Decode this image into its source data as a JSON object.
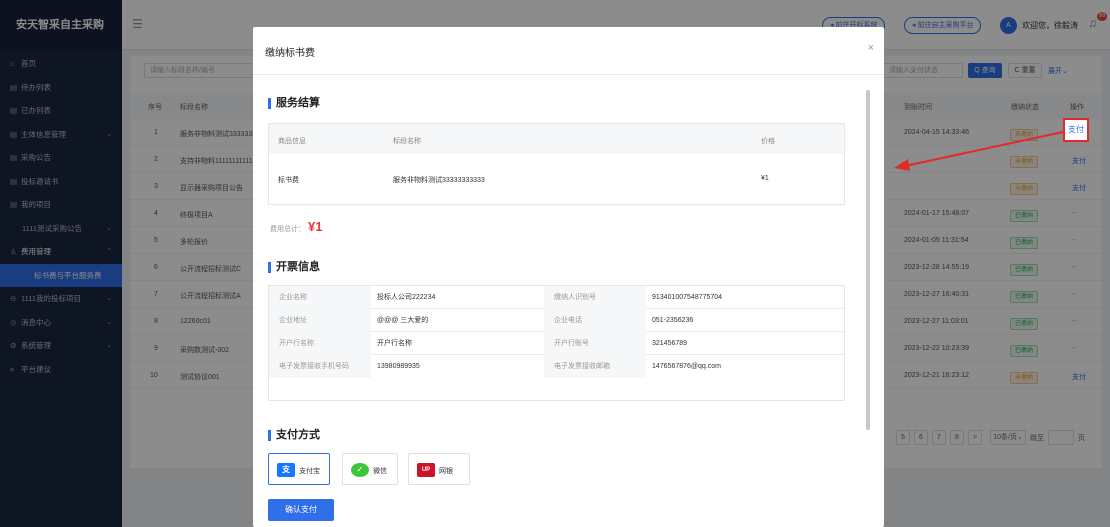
{
  "app": {
    "title": "安天智采自主采购"
  },
  "sidebar": {
    "items": [
      {
        "icon": "⌂",
        "label": "首页"
      },
      {
        "icon": "▤",
        "label": "待办列表"
      },
      {
        "icon": "▤",
        "label": "已办列表"
      },
      {
        "icon": "▤",
        "label": "主体信息管理",
        "arrow": "⌄"
      },
      {
        "icon": "▤",
        "label": "采购公告"
      },
      {
        "icon": "▤",
        "label": "投标邀请书"
      },
      {
        "icon": "▤",
        "label": "我的项目"
      },
      {
        "label": "1111测试采购公告",
        "arrow": "⌄"
      },
      {
        "icon": "♙",
        "label": "费用管理",
        "arrow": "⌃"
      },
      {
        "label": "标书费与平台服务费"
      },
      {
        "icon": "⊖",
        "label": "1111我的投标项目",
        "arrow": "⌄"
      },
      {
        "icon": "◎",
        "label": "消息中心",
        "arrow": "⌄"
      },
      {
        "icon": "⚙",
        "label": "系统管理",
        "arrow": "⌄"
      },
      {
        "icon": "≡",
        "label": "平台建议"
      }
    ]
  },
  "topbar": {
    "link1": "◂ 前往开标系统",
    "link2": "◂ 前往自主采购平台",
    "avatar": "A",
    "welcome": "欢迎您，徐毅涛",
    "badge": "99"
  },
  "filters": {
    "search_placeholder": "请输入标段名称/编号",
    "search2_placeholder": "请输入支付状态",
    "query": "Q 查询",
    "reset": "C 重置",
    "expand": "展开⌄"
  },
  "table": {
    "headers": {
      "index": "序号",
      "name": "标段名称",
      "time": "到账时间",
      "status": "缴纳状态",
      "action": "操作"
    },
    "rows": [
      {
        "index": "1",
        "name": "服务非物料测试33333333333",
        "time": "2024-04-15 14:33:46",
        "status": "未缴纳",
        "action": "支付"
      },
      {
        "index": "2",
        "name": "支持非物料11111111111",
        "time": "",
        "status": "未缴纳",
        "action": "支付"
      },
      {
        "index": "3",
        "name": "显示器采购项目公告",
        "time": "",
        "status": "未缴纳",
        "action": "支付"
      },
      {
        "index": "4",
        "name": "终极项目A",
        "time": "2024-01-17 15:48:07",
        "status": "已缴纳",
        "action": "--"
      },
      {
        "index": "5",
        "name": "多轮报价",
        "time": "2024-01-05 11:31:54",
        "status": "已缴纳",
        "action": "--"
      },
      {
        "index": "6",
        "name": "公开流程招标测试C",
        "time": "2023-12-28 14:55:19",
        "status": "已缴纳",
        "action": "--"
      },
      {
        "index": "7",
        "name": "公开流程招标测试A",
        "time": "2023-12-27 16:40:31",
        "status": "已缴纳",
        "action": "--"
      },
      {
        "index": "8",
        "name": "12260c01",
        "time": "2023-12-27 11:03:01",
        "status": "已缴纳",
        "action": "--"
      },
      {
        "index": "9",
        "name": "采购数测试-002",
        "time": "2023-12-22 10:23:39",
        "status": "已缴纳",
        "action": "--"
      },
      {
        "index": "10",
        "name": "测试协议001",
        "time": "2023-12-21 16:23:12",
        "status": "未缴纳",
        "action": "支付"
      }
    ]
  },
  "pagination": {
    "p5": "5",
    "p6": "6",
    "p7": "7",
    "p8": "8",
    "next": ">",
    "size": "10条/页⌄",
    "goto": "跳至",
    "page_unit": "页"
  },
  "modal": {
    "title": "缴纳标书费",
    "close": "×",
    "service_section": "服务结算",
    "service_headers": {
      "item": "商品信息",
      "name": "标段名称",
      "price": "价格"
    },
    "service_row": {
      "item": "标书费",
      "name": "服务非物料测试33333333333",
      "price": "¥1"
    },
    "total_label": "费用总计：",
    "total_value": "¥1",
    "invoice_section": "开票信息",
    "invoice": [
      {
        "l1": "企业名称",
        "v1": "投标人公司222234",
        "l2": "缴纳人识别号",
        "v2": "913401007548775704"
      },
      {
        "l1": "企业地址",
        "v1": "@@@ 三大爱的",
        "l2": "企业电话",
        "v2": "051-2356236"
      },
      {
        "l1": "开户行名称",
        "v1": "开户行名称",
        "l2": "开户行账号",
        "v2": "321456789"
      },
      {
        "l1": "电子发票接收手机号码",
        "v1": "13980989935",
        "l2": "电子发票接收邮箱",
        "v2": "1476567876@qq.com"
      }
    ],
    "payment_section": "支付方式",
    "payments": [
      {
        "icon": "支",
        "label": "支付宝",
        "color": "#1677ff"
      },
      {
        "icon": "✓",
        "label": "微信",
        "color": "#3cc53c"
      },
      {
        "icon": "UP",
        "label": "网银",
        "color": "#d0112b"
      }
    ],
    "confirm": "确认支付"
  },
  "highlight": {
    "label": "支付"
  },
  "colors": {
    "primary": "#2f6fea",
    "sidebar": "#1b2740",
    "annotation": "#e12a2a"
  }
}
